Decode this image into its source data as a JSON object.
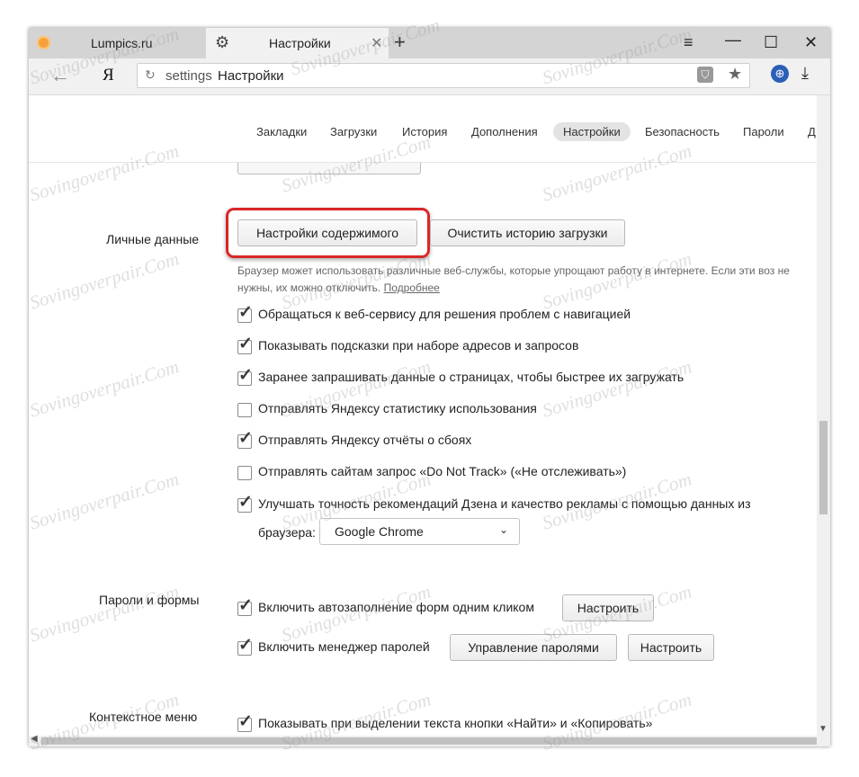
{
  "tabs": [
    {
      "title": "Lumpics.ru",
      "icon": "orange-favicon-icon"
    },
    {
      "title": "Настройки",
      "icon": "gear-icon"
    }
  ],
  "window_controls": {
    "menu": "≡",
    "minimize": "—",
    "maximize": "☐",
    "close": "✕"
  },
  "toolbar": {
    "yandex_logo": "Я",
    "address_scheme": "settings",
    "address_title": "Настройки"
  },
  "nav": [
    "Закладки",
    "Загрузки",
    "История",
    "Дополнения",
    "Настройки",
    "Безопасность",
    "Пароли",
    "Д"
  ],
  "nav_active_index": 4,
  "personal": {
    "label": "Личные данные",
    "content_settings_button": "Настройки содержимого",
    "clear_download_history_button": "Очистить историю загрузки",
    "description": "Браузер может использовать различные веб-службы, которые упрощают работу в интернете. Если эти воз не нужны, их можно отключить.",
    "more_link": "Подробнее",
    "checkboxes": [
      {
        "label": "Обращаться к веб-сервису для решения проблем с навигацией",
        "checked": true
      },
      {
        "label": "Показывать подсказки при наборе адресов и запросов",
        "checked": true
      },
      {
        "label": "Заранее запрашивать данные о страницах, чтобы быстрее их загружать",
        "checked": true
      },
      {
        "label": "Отправлять Яндексу статистику использования",
        "checked": false
      },
      {
        "label": "Отправлять Яндексу отчёты о сбоях",
        "checked": true
      },
      {
        "label": "Отправлять сайтам запрос «Do Not Track» («Не отслеживать»)",
        "checked": false
      },
      {
        "label": "Улучшать точность рекомендаций Дзена и качество рекламы с помощью данных из",
        "checked": true
      }
    ],
    "browser_label": "браузера:",
    "browser_select": "Google Chrome"
  },
  "passwords": {
    "label": "Пароли и формы",
    "autofill": {
      "label": "Включить автозаполнение форм одним кликом",
      "checked": true,
      "button": "Настроить"
    },
    "manager": {
      "label": "Включить менеджер паролей",
      "checked": true,
      "manage_button": "Управление паролями",
      "setup_button": "Настроить"
    }
  },
  "context_menu": {
    "label": "Контекстное меню",
    "show_buttons": {
      "label": "Показывать при выделении текста кнопки «Найти» и «Копировать»",
      "checked": true
    }
  },
  "watermark": "Sovingoverpair.Com",
  "colors": {
    "highlight": "#d92727",
    "tabbar": "#d4d4d4",
    "active_tab": "#f1f1f1"
  }
}
